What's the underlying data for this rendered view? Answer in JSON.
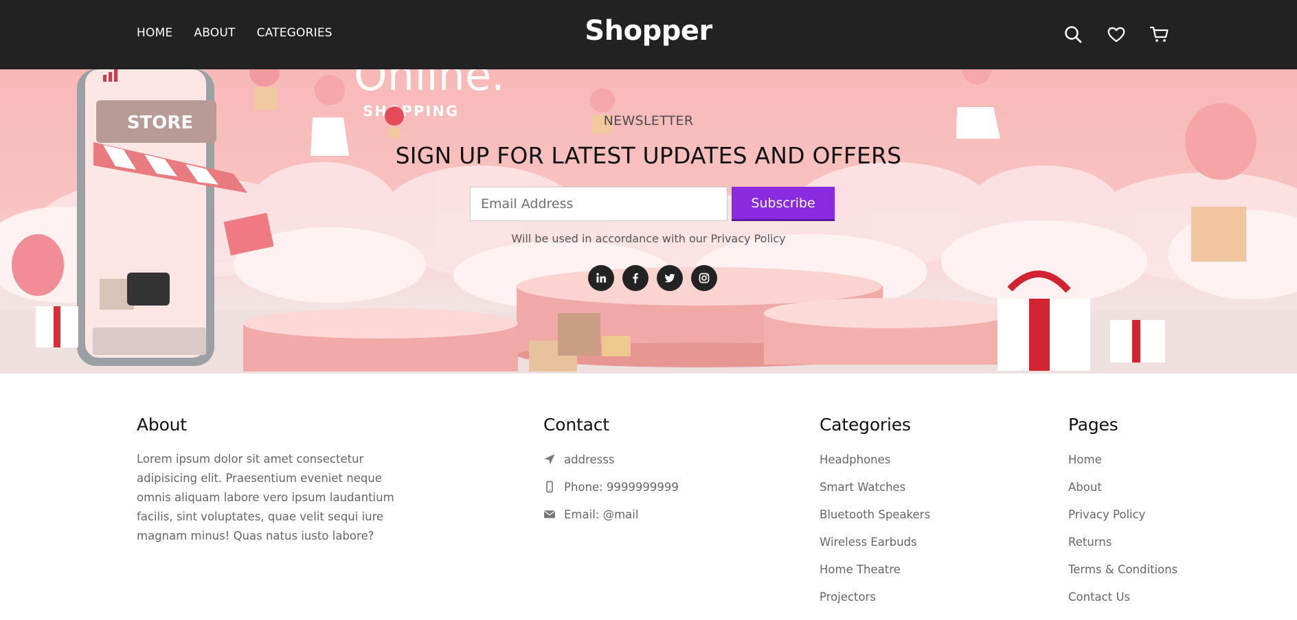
{
  "header": {
    "nav": [
      "HOME",
      "ABOUT",
      "CATEGORIES"
    ],
    "brand": "Shopper",
    "icons": [
      "search-icon",
      "heart-icon",
      "cart-icon"
    ]
  },
  "hero_art": {
    "banner_text": "Online.",
    "banner_subtext": "SHOPPING",
    "store_sign": "STORE"
  },
  "newsletter": {
    "eyebrow": "NEWSLETTER",
    "title": "SIGN UP FOR LATEST UPDATES AND OFFERS",
    "email_placeholder": "Email Address",
    "subscribe_label": "Subscribe",
    "note": "Will be used in accordance with our Privacy Policy",
    "socials": [
      "linkedin-icon",
      "facebook-icon",
      "twitter-icon",
      "instagram-icon"
    ],
    "button_color": "#8a2be2"
  },
  "footer": {
    "about": {
      "title": "About",
      "text": "Lorem ipsum dolor sit amet consectetur adipisicing elit. Praesentium eveniet neque omnis aliquam labore vero ipsum laudantium facilis, sint voluptates, quae velit sequi iure magnam minus! Quas natus iusto labore?"
    },
    "contact": {
      "title": "Contact",
      "address": "addresss",
      "phone": "Phone: 9999999999",
      "email": "Email: @mail"
    },
    "categories": {
      "title": "Categories",
      "items": [
        "Headphones",
        "Smart Watches",
        "Bluetooth Speakers",
        "Wireless Earbuds",
        "Home Theatre",
        "Projectors"
      ]
    },
    "pages": {
      "title": "Pages",
      "items": [
        "Home",
        "About",
        "Privacy Policy",
        "Returns",
        "Terms & Conditions",
        "Contact Us"
      ]
    }
  },
  "colors": {
    "header_bg": "#222222",
    "accent": "#8a2be2",
    "hero_pink": "#f8b8b8"
  }
}
